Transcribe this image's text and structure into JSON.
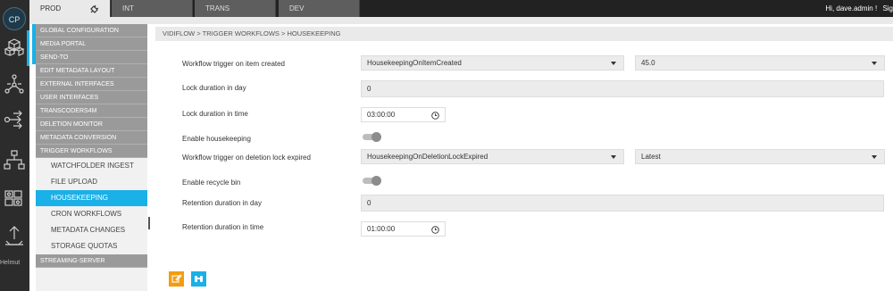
{
  "rail": {
    "avatar_initials": "CP",
    "icons": [
      "cubes-icon",
      "network-icon",
      "transfer-icon",
      "hierarchy-icon",
      "blocks-icon",
      "upload-icon"
    ],
    "broken_image_alt": "Helmut"
  },
  "topbar": {
    "tabs": [
      {
        "label": "PROD",
        "active": true
      },
      {
        "label": "INT",
        "active": false
      },
      {
        "label": "TRANS",
        "active": false
      },
      {
        "label": "DEV",
        "active": false
      }
    ],
    "greeting": "Hi, dave.admin !",
    "signout_partial": "Sig"
  },
  "sidebar": {
    "sections": [
      "GLOBAL CONFIGURATION",
      "MEDIA PORTAL",
      "SEND-TO",
      "EDIT METADATA LAYOUT",
      "EXTERNAL INTERFACES",
      "USER INTERFACES",
      "TRANSCODERS4M",
      "DELETION MONITOR",
      "METADATA CONVERSION",
      "TRIGGER WORKFLOWS"
    ],
    "subitems": [
      {
        "label": "WATCHFOLDER INGEST",
        "active": false
      },
      {
        "label": "FILE UPLOAD",
        "active": false
      },
      {
        "label": "HOUSEKEEPING",
        "active": true
      },
      {
        "label": "CRON WORKFLOWS",
        "active": false
      },
      {
        "label": "METADATA CHANGES",
        "active": false
      },
      {
        "label": "STORAGE QUOTAS",
        "active": false
      }
    ],
    "footer_section": "STREAMING-SERVER"
  },
  "main": {
    "breadcrumb": "VIDIFLOW > TRIGGER WORKFLOWS > HOUSEKEEPING",
    "fields": {
      "trigger_created_label": "Workflow trigger on item created",
      "trigger_created_workflow": "HousekeepingOnItemCreated",
      "trigger_created_version": "45.0",
      "lock_day_label": "Lock duration in day",
      "lock_day_value": "0",
      "lock_time_label": "Lock duration in time",
      "lock_time_value": "03:00:00",
      "enable_housekeeping_label": "Enable housekeeping",
      "trigger_deletion_label": "Workflow trigger on deletion lock expired",
      "trigger_deletion_workflow": "HousekeepingOnDeletionLockExpired",
      "trigger_deletion_version": "Latest",
      "enable_recycle_label": "Enable recycle bin",
      "retention_day_label": "Retention duration in day",
      "retention_day_value": "0",
      "retention_time_label": "Retention duration in time",
      "retention_time_value": "01:00:00"
    },
    "colors": {
      "accent": "#1ab0e8",
      "edit_button": "#f39c12",
      "sidebar_section": "#9a9a9a"
    }
  }
}
